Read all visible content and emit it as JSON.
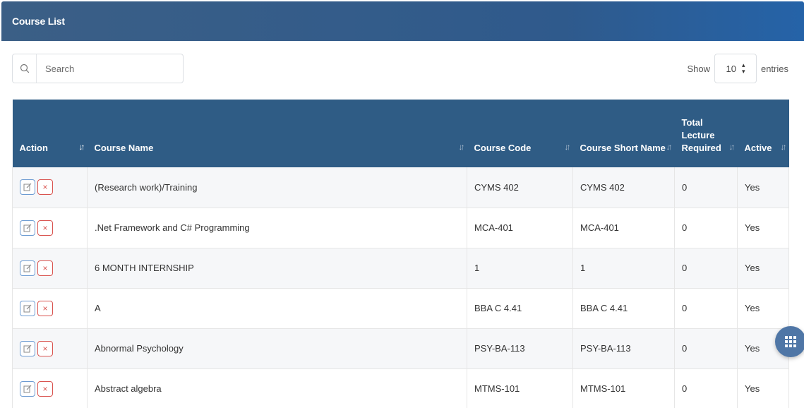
{
  "panel": {
    "title": "Course List"
  },
  "search": {
    "placeholder": "Search"
  },
  "entries": {
    "show_label": "Show",
    "value": "10",
    "suffix": "entries"
  },
  "table": {
    "headers": [
      {
        "label": "Action",
        "sort": "↓↑"
      },
      {
        "label": "Course Name",
        "sort": "↓↑"
      },
      {
        "label": "Course Code",
        "sort": "↓↑"
      },
      {
        "label": "Course Short Name",
        "sort": "↓↑"
      },
      {
        "label": "Total Lecture Required",
        "sort": "↓↑"
      },
      {
        "label": "Active",
        "sort": "↓↑"
      }
    ],
    "rows": [
      {
        "name": "(Research work)/Training",
        "code": "CYMS 402",
        "short": "CYMS 402",
        "lectures": "0",
        "active": "Yes"
      },
      {
        "name": ".Net Framework and C# Programming",
        "code": "MCA-401",
        "short": "MCA-401",
        "lectures": "0",
        "active": "Yes"
      },
      {
        "name": "6 MONTH INTERNSHIP",
        "code": "1",
        "short": "1",
        "lectures": "0",
        "active": "Yes"
      },
      {
        "name": "A",
        "code": "BBA C 4.41",
        "short": "BBA C 4.41",
        "lectures": "0",
        "active": "Yes"
      },
      {
        "name": "Abnormal Psychology",
        "code": "PSY-BA-113",
        "short": "PSY-BA-113",
        "lectures": "0",
        "active": "Yes"
      },
      {
        "name": "Abstract algebra",
        "code": "MTMS-101",
        "short": "MTMS-101",
        "lectures": "0",
        "active": "Yes"
      }
    ],
    "delete_glyph": "×"
  },
  "colors": {
    "header": "#2f5c85",
    "accent": "#2563a8",
    "delete": "#d9534f",
    "edit": "#6c9bd2"
  },
  "icons": {
    "search": "search-icon",
    "edit": "edit-icon",
    "delete": "close-icon",
    "apps": "grid-icon"
  }
}
